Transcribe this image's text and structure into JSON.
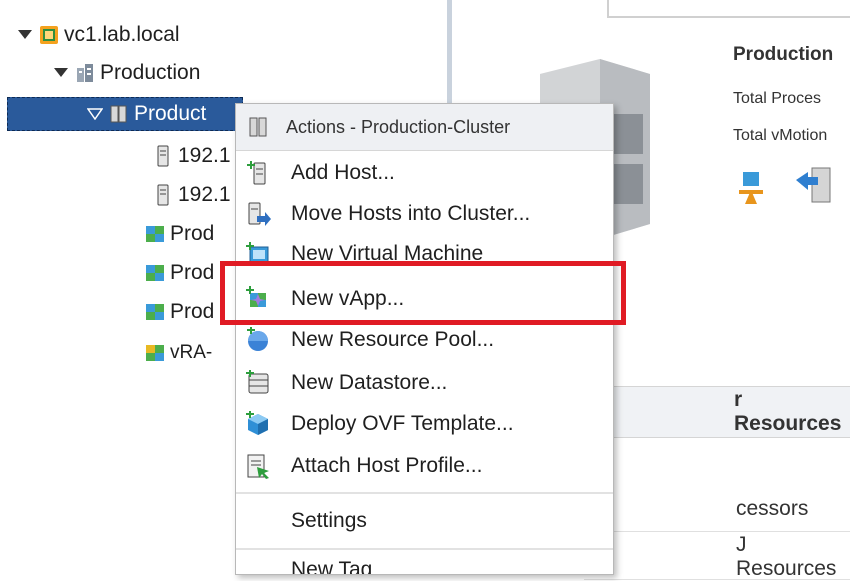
{
  "tree": {
    "root_label": "vc1.lab.local",
    "datacenter_label": "Production",
    "cluster_label": "Product",
    "hosts": [
      "192.1",
      "192.1"
    ],
    "children": [
      {
        "label": "Prod",
        "icon": "vapp-icon"
      },
      {
        "label": "Prod",
        "icon": "vapp-icon"
      },
      {
        "label": "Prod",
        "icon": "vapp-icon"
      },
      {
        "label": "vRA-",
        "icon": "vapp-icon"
      }
    ]
  },
  "summary": {
    "title": "Production",
    "stat_1": "Total Proces",
    "stat_2": "Total vMotion",
    "resources_header": "r Resources",
    "row_1": "cessors",
    "row_2": "J Resources"
  },
  "context_menu": {
    "header": "Actions - Production-Cluster",
    "items": [
      {
        "label": "Add Host...",
        "icon": "add-host-icon"
      },
      {
        "label": "Move Hosts into Cluster...",
        "icon": "move-hosts-icon"
      },
      {
        "label": "New Virtual Machine",
        "icon": "new-vm-icon"
      },
      {
        "label": "New vApp...",
        "icon": "new-vapp-icon"
      },
      {
        "label": "New Resource Pool...",
        "icon": "resource-pool-icon"
      },
      {
        "label": "New Datastore...",
        "icon": "datastore-icon"
      },
      {
        "label": "Deploy OVF Template...",
        "icon": "ovf-template-icon"
      },
      {
        "label": "Attach Host Profile...",
        "icon": "host-profile-icon"
      },
      {
        "label": "Settings",
        "icon": ""
      },
      {
        "label": "New Tag",
        "icon": ""
      }
    ]
  },
  "colors": {
    "selection": "#2a5a9b",
    "highlight": "#e01b24",
    "menu_header_bg": "#eef0f3"
  }
}
